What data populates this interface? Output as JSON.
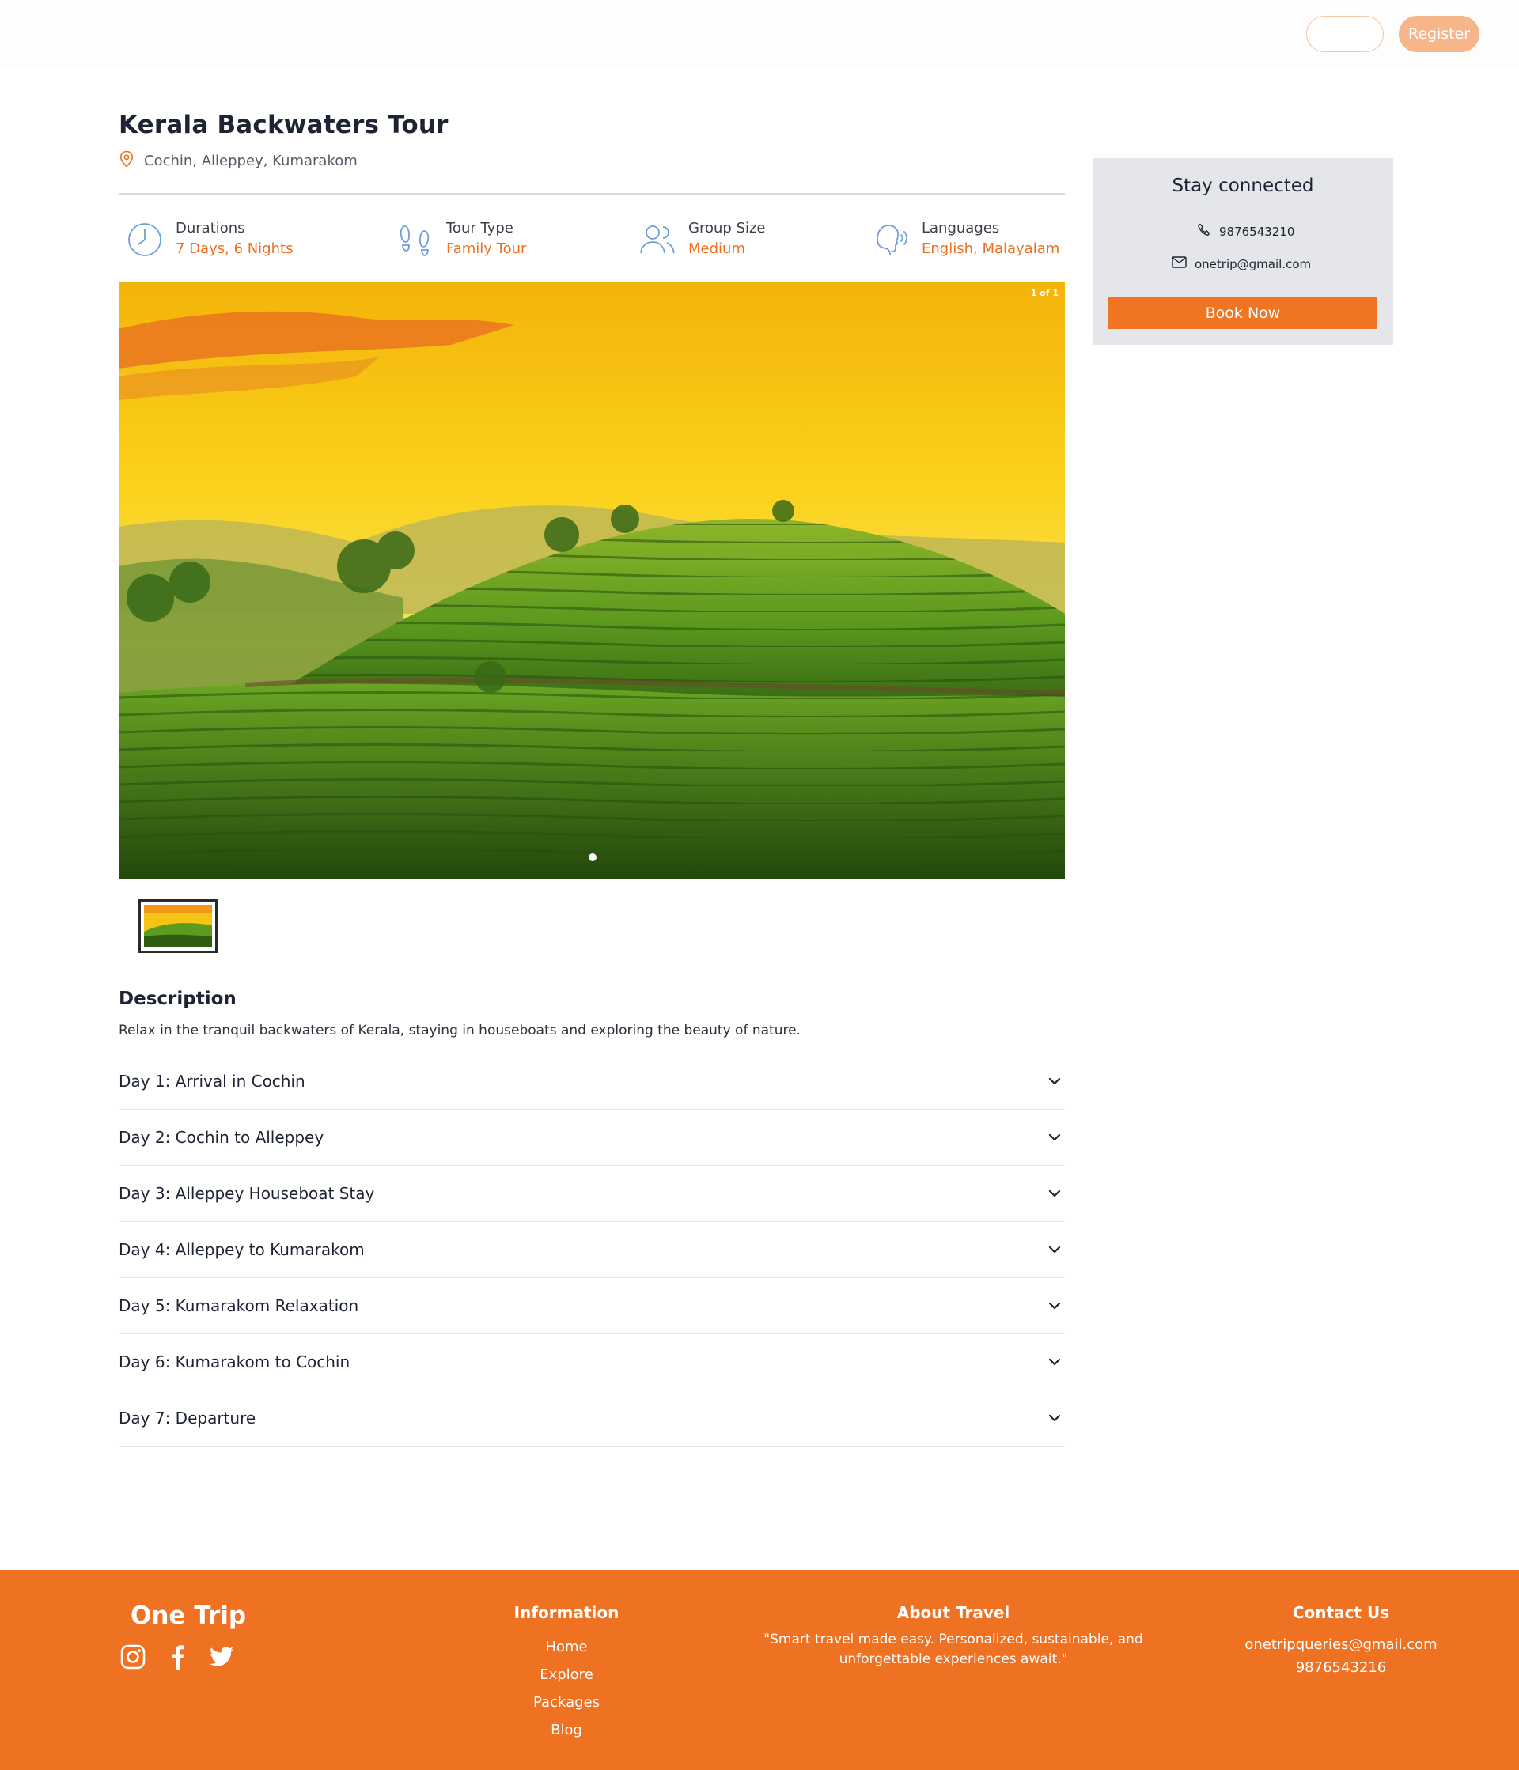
{
  "header": {
    "brand": "One Trip",
    "login_label": "",
    "register_label": "Register"
  },
  "tour": {
    "title": "Kerala Backwaters Tour",
    "location": "Cochin, Alleppey, Kumarakom",
    "info": [
      {
        "label": "Durations",
        "value": "7 Days, 6 Nights",
        "icon": "clock-icon"
      },
      {
        "label": "Tour Type",
        "value": "Family Tour",
        "icon": "footprints-icon"
      },
      {
        "label": "Group Size",
        "value": "Medium",
        "icon": "users-icon"
      },
      {
        "label": "Languages",
        "value": "English, Malayalam",
        "icon": "speaking-head-icon"
      }
    ]
  },
  "gallery": {
    "counter": "1 of 1",
    "image_alt": "tea plantation hills at sunset"
  },
  "description": {
    "title": "Description",
    "text": "Relax in the tranquil backwaters of Kerala, staying in houseboats and exploring the beauty of nature."
  },
  "itinerary": [
    "Day 1: Arrival in Cochin",
    "Day 2: Cochin to Alleppey",
    "Day 3: Alleppey Houseboat Stay",
    "Day 4: Alleppey to Kumarakom",
    "Day 5: Kumarakom Relaxation",
    "Day 6: Kumarakom to Cochin",
    "Day 7: Departure"
  ],
  "sidebar": {
    "title": "Stay connected",
    "phone": "9876543210",
    "email": "onetrip@gmail.com",
    "book_label": "Book Now"
  },
  "footer": {
    "brand": "One Trip",
    "information": {
      "title": "Information",
      "links": [
        "Home",
        "Explore",
        "Packages",
        "Blog"
      ]
    },
    "about": {
      "title": "About Travel",
      "text": "\"Smart travel made easy. Personalized, sustainable, and unforgettable experiences await.\""
    },
    "contact": {
      "title": "Contact Us",
      "email": "onetripqueries@gmail.com",
      "phone": "9876543216"
    }
  },
  "colors": {
    "accent": "#ef7122",
    "accent_text": "#ef6f1f",
    "sidebar_bg": "#e5e6e9",
    "register_bg": "#f7b58a"
  }
}
